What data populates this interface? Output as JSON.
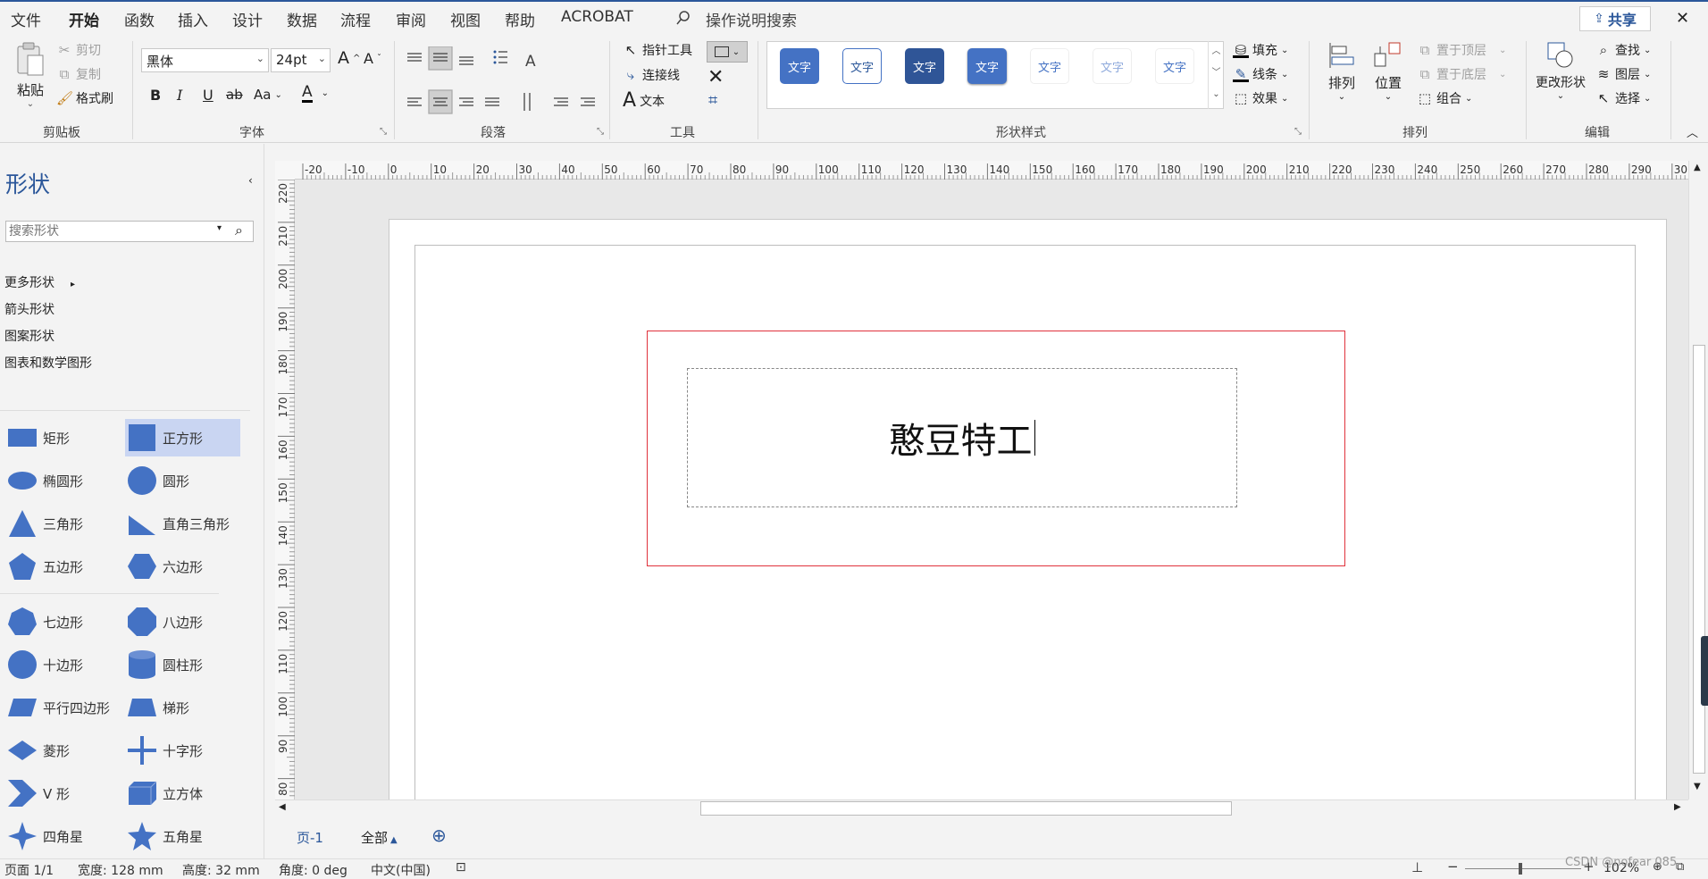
{
  "menu": {
    "tabs": [
      "文件",
      "开始",
      "函数",
      "插入",
      "设计",
      "数据",
      "流程",
      "审阅",
      "视图",
      "帮助",
      "ACROBAT"
    ],
    "search_label": "操作说明搜索",
    "share_label": "共享",
    "close_glyph": "✕"
  },
  "ribbon": {
    "clipboard": {
      "paste": "粘贴",
      "cut": "剪切",
      "copy": "复制",
      "format_painter": "格式刷",
      "group": "剪贴板"
    },
    "font": {
      "name": "黑体",
      "size": "24pt",
      "bold": "B",
      "italic": "I",
      "underline": "U",
      "strike": "ab",
      "case": "Aa",
      "color_letter": "A",
      "group": "字体",
      "grow": "A",
      "shrink": "A"
    },
    "paragraph": {
      "group": "段落"
    },
    "tools": {
      "pointer": "指针工具",
      "connector": "连接线",
      "text": "文本",
      "text_glyph": "A",
      "group": "工具"
    },
    "shape_styles": {
      "label": "文字",
      "group": "形状样式",
      "fill": "填充",
      "line": "线条",
      "effect": "效果"
    },
    "arrange": {
      "arrange": "排列",
      "position": "位置",
      "bring_front": "置于顶层",
      "send_back": "置于底层",
      "group_btn": "组合",
      "group": "排列"
    },
    "edit": {
      "change_shape": "更改形状",
      "find": "查找",
      "layers": "图层",
      "select": "选择",
      "group": "编辑"
    }
  },
  "sidebar": {
    "title": "形状",
    "search_placeholder": "搜索形状",
    "links": [
      "更多形状",
      "箭头形状",
      "图案形状",
      "图表和数学图形"
    ],
    "shapes": [
      "矩形",
      "正方形",
      "椭圆形",
      "圆形",
      "三角形",
      "直角三角形",
      "五边形",
      "六边形",
      "七边形",
      "八边形",
      "十边形",
      "圆柱形",
      "平行四边形",
      "梯形",
      "菱形",
      "十字形",
      "V 形",
      "立方体",
      "四角星",
      "五角星"
    ]
  },
  "ruler": {
    "h_ticks": [
      "-20",
      "-10",
      "0",
      "10",
      "20",
      "30",
      "40",
      "50",
      "60",
      "70",
      "80",
      "90",
      "100",
      "110",
      "120",
      "130",
      "140",
      "150",
      "160",
      "170",
      "180",
      "190",
      "200",
      "210",
      "220",
      "230",
      "240",
      "250",
      "260",
      "270",
      "280",
      "290",
      "30"
    ],
    "v_ticks": [
      "220",
      "210",
      "200",
      "190",
      "180",
      "170",
      "160",
      "150",
      "140",
      "130",
      "120",
      "110",
      "100",
      "90",
      "80"
    ]
  },
  "canvas": {
    "shape_text": "憨豆特工"
  },
  "tabs": {
    "page": "页-1",
    "all": "全部",
    "add": "⊕"
  },
  "status": {
    "page": "页面 1/1",
    "width": "宽度: 128 mm",
    "height": "高度: 32 mm",
    "angle": "角度: 0 deg",
    "lang": "中文(中国)",
    "zoom": "102%",
    "watermark": "CSDN @nofear 085"
  },
  "colors": {
    "accent": "#2b579a",
    "shape_blue": "#4472c4",
    "selection_red": "#e0323c"
  }
}
